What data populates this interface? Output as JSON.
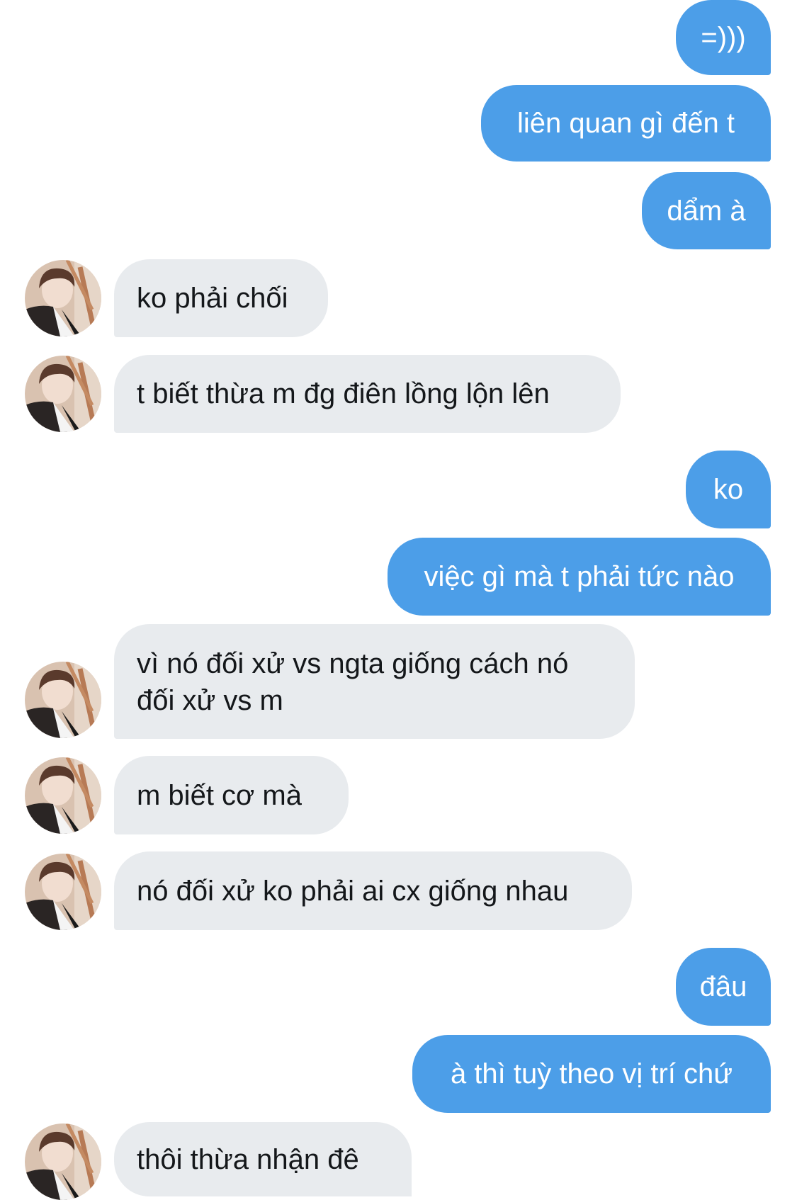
{
  "conversation": {
    "messages": [
      {
        "side": "out",
        "text": "=)))"
      },
      {
        "side": "out",
        "text": "liên quan gì đến t"
      },
      {
        "side": "out",
        "text": "dẩm à"
      },
      {
        "side": "in",
        "text": "ko phải chối"
      },
      {
        "side": "in",
        "text": "t biết thừa m đg điên lồng lộn lên"
      },
      {
        "side": "out",
        "text": "ko"
      },
      {
        "side": "out",
        "text": "việc gì mà t phải tức nào"
      },
      {
        "side": "in",
        "text": "vì nó đối xử vs ngta giống cách nó đối xử vs m"
      },
      {
        "side": "in",
        "text": "m biết cơ mà"
      },
      {
        "side": "in",
        "text": "nó đối xử ko phải ai cx giống nhau"
      },
      {
        "side": "out",
        "text": "đâu"
      },
      {
        "side": "out",
        "text": "à thì tuỳ theo vị trí chứ"
      },
      {
        "side": "in",
        "text": "thôi thừa nhận đê"
      }
    ]
  },
  "colors": {
    "outgoing_bubble": "#4c9ee8",
    "incoming_bubble": "#e8ebee",
    "incoming_text": "#14171a",
    "background": "#ffffff"
  },
  "icons": {
    "avatar": "contact-avatar"
  }
}
